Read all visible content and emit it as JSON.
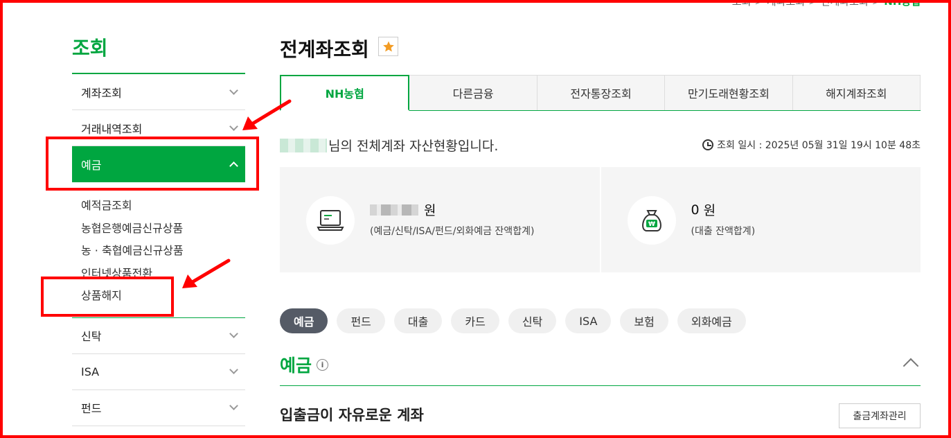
{
  "breadcrumb": {
    "items": [
      "조회",
      "계좌조회",
      "전계좌조회"
    ],
    "current": "NH농협"
  },
  "sidebar": {
    "title": "조회",
    "items": [
      {
        "label": "계좌조회"
      },
      {
        "label": "거래내역조회"
      },
      {
        "label": "예금"
      }
    ],
    "sub_items": [
      "예적금조회",
      "농협은행예금신규상품",
      "농 · 축협예금신규상품",
      "인터넷상품전환",
      "상품해지"
    ],
    "lower_items": [
      {
        "label": "신탁"
      },
      {
        "label": "ISA"
      },
      {
        "label": "펀드"
      }
    ]
  },
  "main": {
    "title": "전계좌조회",
    "favorite_icon": "star-icon",
    "tabs": [
      "NH농협",
      "다른금융",
      "전자통장조회",
      "만기도래현황조회",
      "해지계좌조회"
    ],
    "greeting": "님의 전체계좌 자산현황입니다.",
    "time_label": "조회 일시 : 2025년 05월 31일 19시 10분 48초",
    "summary": {
      "assets": {
        "unit": "원",
        "desc": "(예금/신탁/ISA/펀드/외화예금 잔액합계)",
        "icon": "laptop-icon"
      },
      "loans": {
        "amount": "0",
        "unit": "원",
        "desc": "(대출 잔액합계)",
        "icon": "money-bag-icon"
      }
    },
    "chips": [
      "예금",
      "펀드",
      "대출",
      "카드",
      "신탁",
      "ISA",
      "보험",
      "외화예금"
    ],
    "section_title": "예금",
    "info_glyph": "i",
    "subsection_title": "입출금이 자유로운 계좌",
    "manage_button": "출금계좌관리"
  },
  "colors": {
    "brand_green": "#00a640",
    "annotation_red": "#ff0000",
    "chip_active": "#555b66",
    "star": "#f39c24"
  }
}
